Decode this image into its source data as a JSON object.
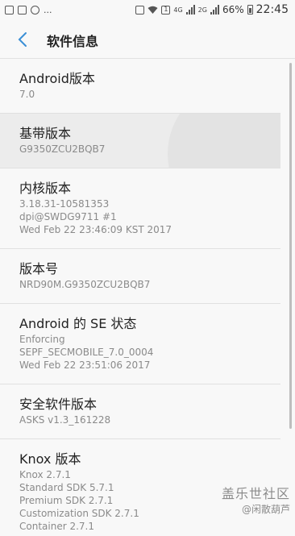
{
  "status_bar": {
    "time": "22:45",
    "battery_percent": "66%",
    "left_text": "...",
    "network_label": "4G",
    "network_label_2": "2G",
    "sim_label": "1",
    "battery_level": 0.66
  },
  "header": {
    "title": "软件信息"
  },
  "items": [
    {
      "title": "Android版本",
      "lines": [
        "7.0"
      ]
    },
    {
      "title": "基带版本",
      "lines": [
        "G9350ZCU2BQB7"
      ]
    },
    {
      "title": "内核版本",
      "lines": [
        "3.18.31-10581353",
        "dpi@SWDG9711 #1",
        "Wed Feb 22 23:46:09 KST 2017"
      ]
    },
    {
      "title": "版本号",
      "lines": [
        "NRD90M.G9350ZCU2BQB7"
      ]
    },
    {
      "title": "Android 的 SE 状态",
      "lines": [
        "Enforcing",
        "SEPF_SECMOBILE_7.0_0004",
        "Wed Feb 22 23:51:06 2017"
      ]
    },
    {
      "title": "安全软件版本",
      "lines": [
        "ASKS v1.3_161228"
      ]
    },
    {
      "title": "Knox 版本",
      "lines": [
        "Knox 2.7.1",
        "Standard SDK 5.7.1",
        "Premium SDK 2.7.1",
        "Customization SDK 2.7.1",
        "Container 2.7.1"
      ]
    }
  ],
  "watermark": {
    "logo": "盖乐世社区",
    "user": "@闲散葫芦"
  }
}
